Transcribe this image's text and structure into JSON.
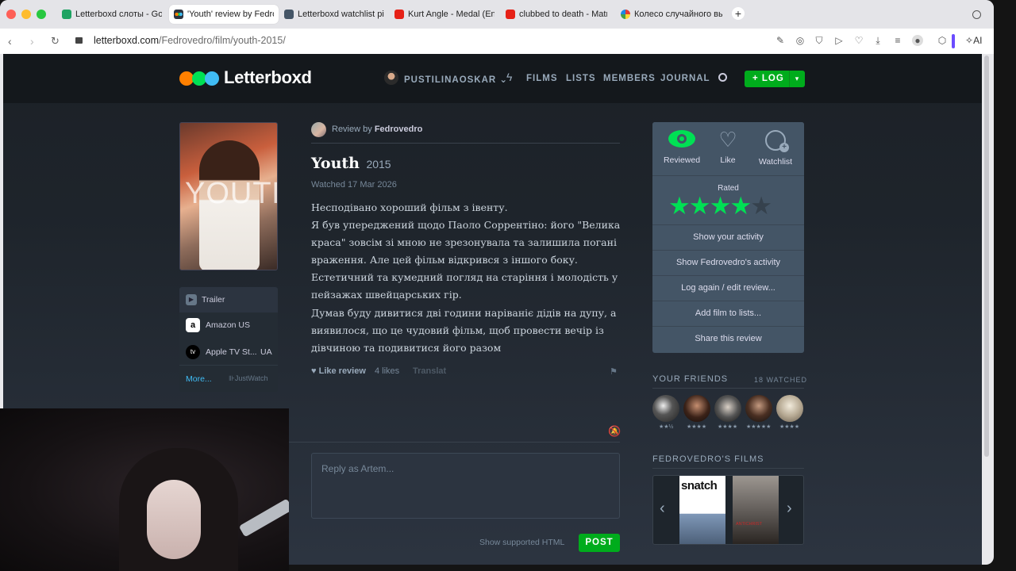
{
  "browser": {
    "tabs": [
      {
        "title": "Letterboxd слоты - Goog",
        "icon_color": "#1ea362"
      },
      {
        "title": "'Youth' review by Fedrov",
        "icon_color": "#445566",
        "active": true
      },
      {
        "title": "Letterboxd watchlist pic",
        "icon_color": "#445566"
      },
      {
        "title": "Kurt Angle - Medal (Entr",
        "icon_color": "#e62117"
      },
      {
        "title": "clubbed to death - Matri",
        "icon_color": "#e62117"
      },
      {
        "title": "Колесо случайного вы",
        "icon_color": "#9c27b0"
      }
    ],
    "url_domain": "letterboxd.com",
    "url_path": "/Fedrovedro/film/youth-2015/",
    "ai_label": "AI"
  },
  "header": {
    "logo": "Letterboxd",
    "user": "PUSTILINAOSKAR",
    "nav": [
      "FILMS",
      "LISTS",
      "MEMBERS",
      "JOURNAL"
    ],
    "log_label": "+ LOG"
  },
  "film": {
    "poster_title": "YOUTH",
    "watch_links": [
      {
        "label": "Trailer"
      },
      {
        "label": "Amazon US"
      },
      {
        "label": "Apple TV St...",
        "region": "UA"
      }
    ],
    "more_label": "More...",
    "justwatch_label": "JustWatch"
  },
  "review": {
    "by_prefix": "Review by",
    "author": "Fedrovedro",
    "title": "Youth",
    "year": "2015",
    "watched": "Watched 17 Mar 2026",
    "paragraphs": [
      "Несподівано хороший фільм з івенту.",
      "Я був упереджений щодо Паоло Соррентіно: його \"Велика краса\" зовсім зі мною не зрезонувала та залишила погані враження. Але цей фільм відкрився з іншого боку. Естетичний та кумедний погляд на старіння і молодість у пейзажах швейцарських гір.",
      "Думав буду дивитися дві години наріваніє дідів на дупу, а виявилося, що це чудовий фільм, щоб провести вечір із дівчиною та подивитися його разом"
    ],
    "like_label": "Like review",
    "likes": "4 likes",
    "translate_label": "Translat",
    "reply_placeholder": "Reply as Artem...",
    "html_label": "Show supported HTML",
    "post_label": "POST"
  },
  "actions": {
    "reviewed_label": "Reviewed",
    "like_label": "Like",
    "watchlist_label": "Watchlist",
    "rated_label": "Rated",
    "rating": 4,
    "rating_max": 5,
    "rows": [
      "Show your activity",
      "Show Fedrovedro's activity",
      "Log again / edit review...",
      "Add film to lists...",
      "Share this review"
    ]
  },
  "friends": {
    "title": "YOUR FRIENDS",
    "watched": "18 WATCHED",
    "ratings": [
      "★★½",
      "★★★★",
      "★★★★",
      "★★★★★",
      "★★★★"
    ]
  },
  "author_films": {
    "title": "FEDROVEDRO'S FILMS",
    "films": [
      "snatch",
      "ANTICHRIST"
    ]
  },
  "colors": {
    "accent_green": "#00ac1c",
    "star_green": "#00e054"
  }
}
